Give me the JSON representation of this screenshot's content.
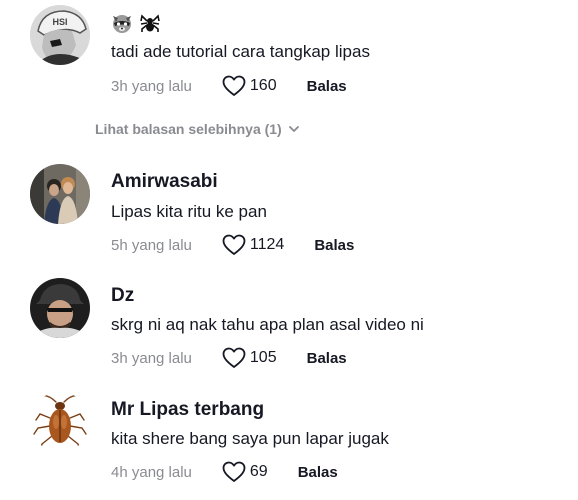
{
  "comments": [
    {
      "name": "",
      "name_emojis": [
        "raccoon-emoji",
        "spider-emoji"
      ],
      "text": "tadi ade tutorial cara tangkap lipas",
      "time": "3h yang lalu",
      "likes": "160",
      "reply_label": "Balas",
      "avatar_text": "HSI"
    },
    {
      "name": "Amirwasabi",
      "text": "Lipas kita ritu ke pan",
      "time": "5h yang lalu",
      "likes": "1124",
      "reply_label": "Balas"
    },
    {
      "name": "Dz",
      "text": "skrg ni aq nak tahu apa plan asal video ni",
      "time": "3h yang lalu",
      "likes": "105",
      "reply_label": "Balas"
    },
    {
      "name": "Mr Lipas terbang",
      "text": "kita shere bang saya pun lapar jugak",
      "time": "4h yang lalu",
      "likes": "69",
      "reply_label": "Balas"
    }
  ],
  "more_replies": "Lihat balasan selebihnya (1)",
  "colors": {
    "text": "#161823",
    "muted": "#8a8b91"
  }
}
